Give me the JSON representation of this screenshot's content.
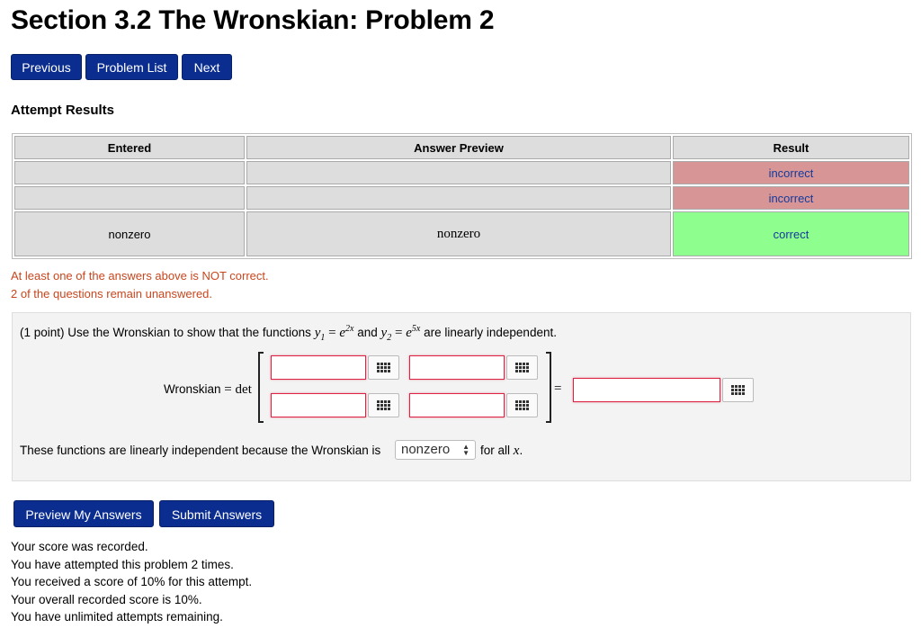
{
  "title": "Section 3.2 The Wronskian: Problem 2",
  "nav": {
    "previous": "Previous",
    "problem_list": "Problem List",
    "next": "Next"
  },
  "attempt_results_title": "Attempt Results",
  "results_table": {
    "headers": [
      "Entered",
      "Answer Preview",
      "Result"
    ],
    "rows": [
      {
        "entered": "",
        "preview": "",
        "result": "incorrect"
      },
      {
        "entered": "",
        "preview": "",
        "result": "incorrect"
      },
      {
        "entered": "nonzero",
        "preview": "nonzero",
        "result": "correct"
      }
    ]
  },
  "messages": {
    "not_correct": "At least one of the answers above is NOT correct.",
    "unanswered": "2 of the questions remain unanswered."
  },
  "problem": {
    "intro_a": "(1 point) Use the Wronskian to show that the functions",
    "y1": "y",
    "y1_sub": "1",
    "eq": "=",
    "e": "e",
    "exp1": "2x",
    "and": "and",
    "y2": "y",
    "y2_sub": "2",
    "exp2": "5x",
    "intro_b": "are linearly independent.",
    "wronskian_label": "Wronskian",
    "det": "det",
    "equals": "=",
    "conclusion_a": "These functions are linearly independent because the Wronskian is",
    "select_value": "nonzero",
    "conclusion_b": "for all",
    "x_var": "x",
    "period": ".",
    "matrix_inputs": [
      "",
      "",
      "",
      ""
    ],
    "result_input": ""
  },
  "actions": {
    "preview": "Preview My Answers",
    "submit": "Submit Answers"
  },
  "score_lines": [
    "Your score was recorded.",
    "You have attempted this problem 2 times.",
    "You received a score of 10% for this attempt.",
    "Your overall recorded score is 10%.",
    "You have unlimited attempts remaining."
  ],
  "colors": {
    "button_blue": "#0a2d8f",
    "incorrect_bg": "#d89595",
    "correct_bg": "#8eff8e",
    "message_orange": "#c8461e"
  }
}
